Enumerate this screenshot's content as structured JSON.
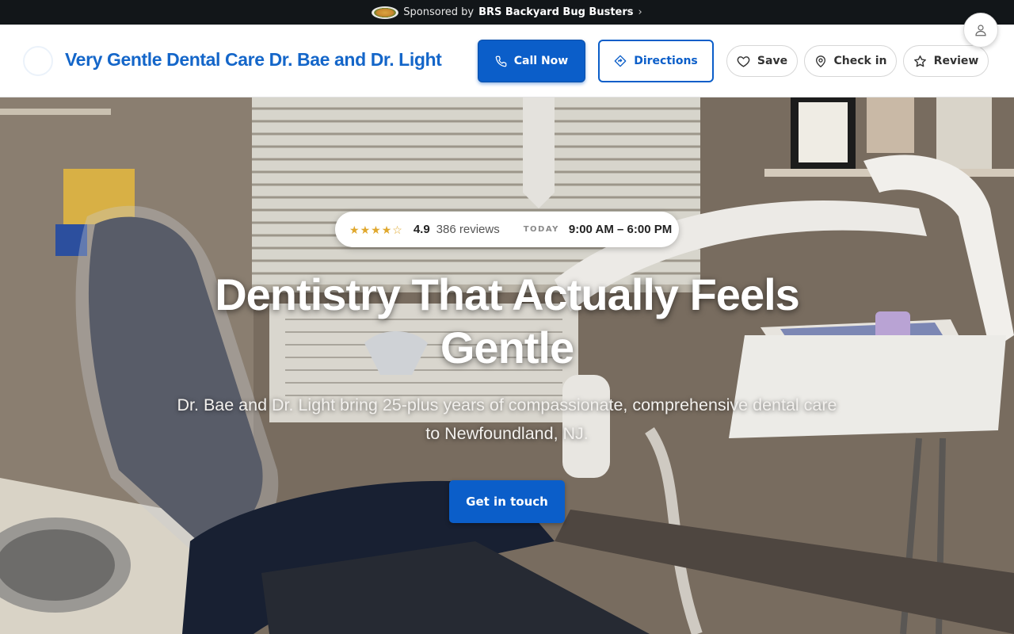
{
  "sponsor": {
    "prefix": "Sponsored by",
    "brand": "BRS Backyard Bug Busters",
    "chevron": "›",
    "logo_icon": "brs-logo"
  },
  "header": {
    "business_name": "Very Gentle Dental Care Dr. Bae and Dr. Light",
    "call_label": "Call Now",
    "directions_label": "Directions",
    "save_label": "Save",
    "checkin_label": "Check in",
    "review_label": "Review",
    "icons": {
      "call": "phone-icon",
      "directions": "directions-icon",
      "save": "heart-icon",
      "checkin": "map-pin-icon",
      "review": "star-icon",
      "account": "user-icon"
    }
  },
  "hero": {
    "rating": {
      "stars_filled": 4.5,
      "stars_total": 5,
      "value": "4.9",
      "count": "386 reviews",
      "today_label": "TODAY",
      "hours": "9:00 AM – 6:00 PM"
    },
    "title": "Dentistry That Actually Feels Gentle",
    "subtitle": "Dr. Bae and Dr. Light bring 25-plus years of compassionate, comprehensive dental care to Newfoundland, NJ.",
    "cta_label": "Get in touch",
    "background": "dental-office-photo"
  },
  "colors": {
    "brand_blue": "#0b5ec9",
    "name_blue": "#1466c9",
    "star_gold": "#e0a82e",
    "sponsor_bar": "#121619"
  }
}
